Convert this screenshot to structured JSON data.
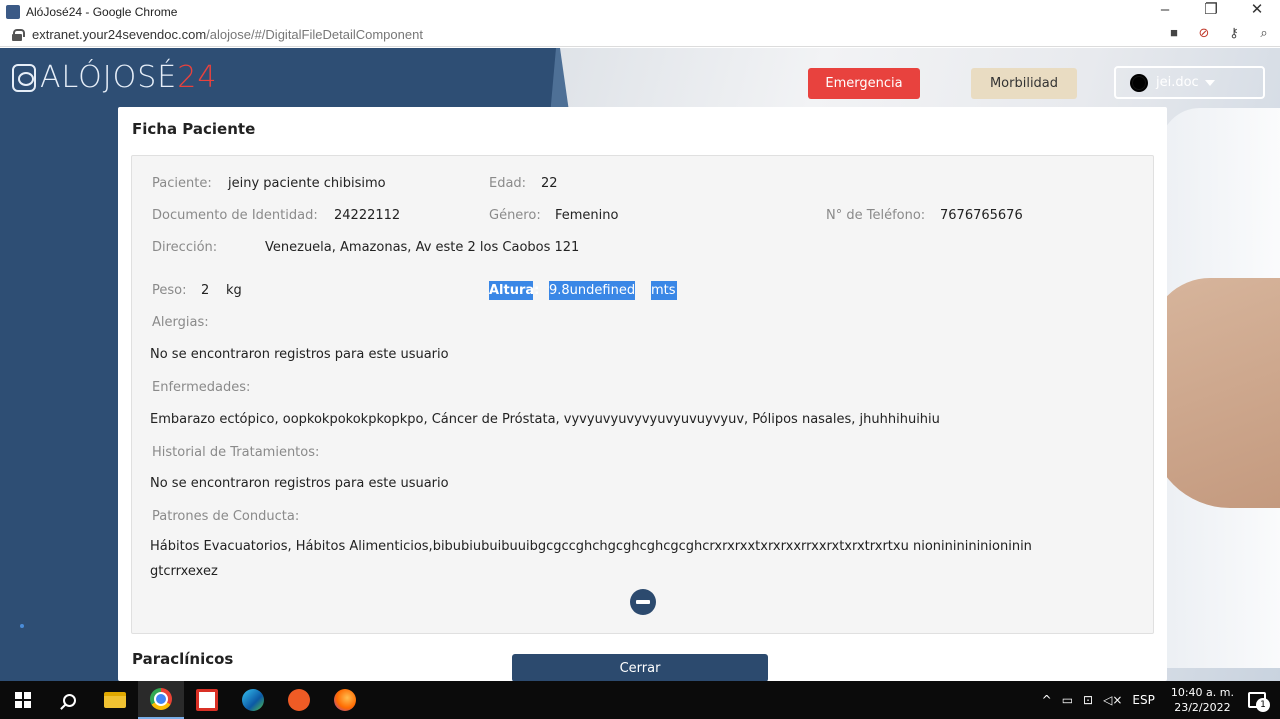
{
  "window": {
    "title": "AlóJosé24 - Google Chrome",
    "controls": {
      "minimize": "–",
      "maximize": "❐",
      "close": "✕"
    }
  },
  "addressbar": {
    "url_host": "extranet.your24sevendoc.com",
    "url_path": "/alojose/#/DigitalFileDetailComponent",
    "icons": [
      "camera-icon",
      "blocked-icon",
      "key-icon",
      "zoom-icon"
    ]
  },
  "header": {
    "logo_text": "ALÓJOSÉ",
    "logo_num": "24",
    "emergency_label": "Emergencia",
    "morbidity_label": "Morbilidad",
    "user_name": "jei.doc"
  },
  "modal": {
    "title": "Ficha Paciente",
    "patient": {
      "paciente_label": "Paciente:",
      "paciente_value": "jeiny paciente chibisimo",
      "edad_label": "Edad:",
      "edad_value": "22",
      "documento_label": "Documento de Identidad:",
      "documento_value": "24222112",
      "genero_label": "Género:",
      "genero_value": "Femenino",
      "telefono_label": "N° de Teléfono:",
      "telefono_value": "7676765676",
      "direccion_label": "Dirección:",
      "direccion_value": "Venezuela, Amazonas, Av este 2 los Caobos 121",
      "peso_label": "Peso:",
      "peso_value": "2",
      "peso_unit": "kg",
      "altura_label": "Altura:",
      "altura_value": "9.8undefined",
      "altura_unit": "mts"
    },
    "sections": {
      "alergias_label": "Alergias:",
      "alergias_value": "No se encontraron registros para este usuario",
      "enfermedades_label": "Enfermedades:",
      "enfermedades_value": "Embarazo ectópico, oopkokpokokpkopkpo, Cáncer de Próstata, vyvyuvyuvyvyuvyuvuyvyuv, Pólipos nasales, jhuhhihuihiu",
      "historial_label": "Historial de Tratamientos:",
      "historial_value": "No se encontraron registros para este usuario",
      "patrones_label": "Patrones de Conducta:",
      "patrones_value_line1": "Hábitos Evacuatorios, Hábitos Alimenticios,bibubiubuibuuibgcgccghchgcghcghcgcghcrxrxrxxtxrxrxxrrxxrxtxrxtrxrtxu nionininininioninin",
      "patrones_value_line2": "gtcrrxexez"
    },
    "paraclinicos_title": "Paraclínicos",
    "close_label": "Cerrar"
  },
  "taskbar": {
    "apps": [
      "start",
      "search",
      "file-explorer",
      "chrome",
      "acrobat",
      "edge",
      "postman",
      "firefox"
    ],
    "tray": {
      "chevron": "^",
      "language": "ESP",
      "time": "10:40 a. m.",
      "date": "23/2/2022",
      "notifications": "1"
    }
  }
}
